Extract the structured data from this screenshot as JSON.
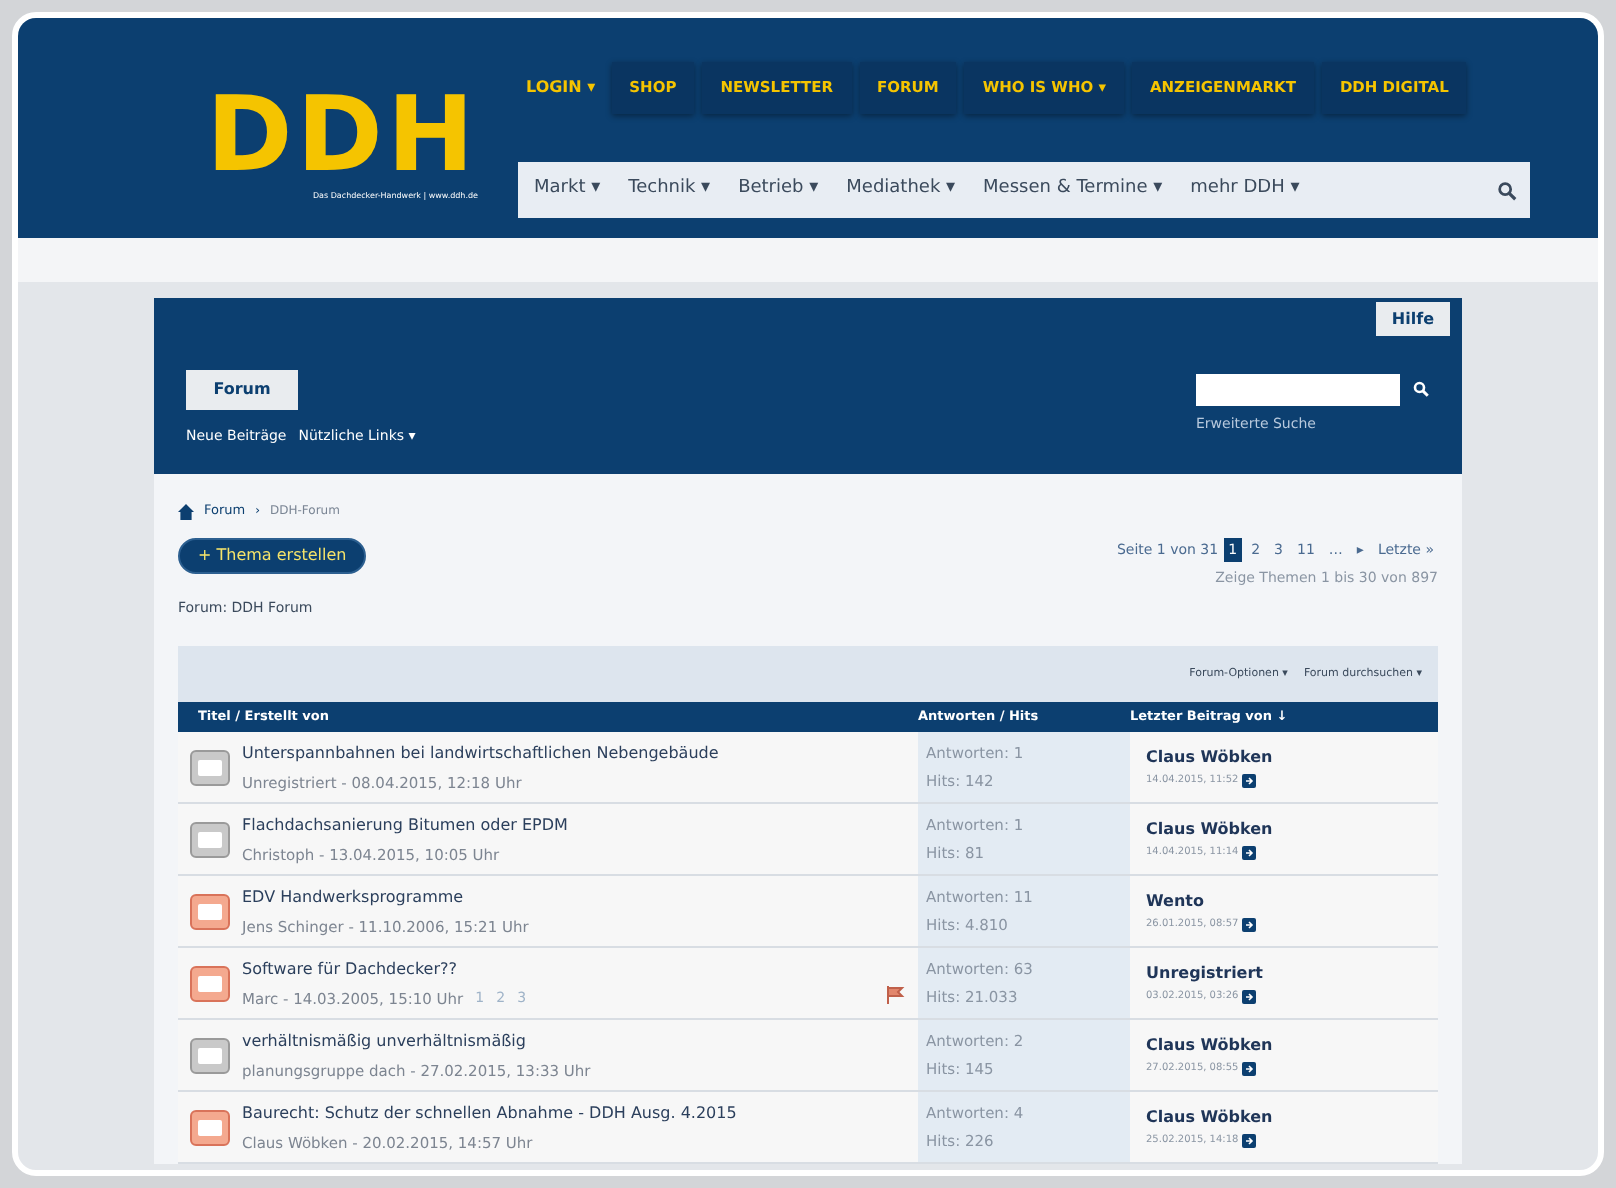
{
  "logo": {
    "text": "DDH",
    "tagline": "Das Dachdecker-Handwerk | www.ddh.de"
  },
  "login": "LOGIN ▾",
  "top_nav": [
    "SHOP",
    "NEWSLETTER",
    "FORUM",
    "WHO IS WHO ▾",
    "ANZEIGENMARKT",
    "DDH DIGITAL"
  ],
  "main_nav": [
    "Markt ▾",
    "Technik ▾",
    "Betrieb ▾",
    "Mediathek ▾",
    "Messen & Termine ▾",
    "mehr DDH ▾"
  ],
  "forum_header": {
    "help": "Hilfe",
    "tab": "Forum",
    "links": [
      "Neue Beiträge",
      "Nützliche Links ▾"
    ],
    "advanced_search": "Erweiterte Suche"
  },
  "breadcrumb": [
    "Forum",
    "›",
    "DDH-Forum"
  ],
  "new_thread": "+ Thema erstellen",
  "pagination": {
    "label": "Seite 1 von 31",
    "pages": [
      {
        "label": "1",
        "selected": true
      },
      {
        "label": "2",
        "selected": false
      },
      {
        "label": "3",
        "selected": false
      },
      {
        "label": "11",
        "selected": false
      },
      {
        "label": "…",
        "selected": false
      },
      {
        "label": "▸",
        "selected": false
      },
      {
        "label": "Letzte »",
        "selected": false
      }
    ],
    "summary": "Zeige Themen 1 bis 30 von 897"
  },
  "forum_title": "Forum: DDH Forum",
  "options": [
    "Forum-Optionen ▾",
    "Forum durchsuchen ▾"
  ],
  "table": {
    "columns": [
      "Titel / Erstellt von",
      "Antworten / Hits",
      "Letzter Beitrag von ↓"
    ],
    "rows": [
      {
        "kind": "normal",
        "title": "Unterspannbahnen bei landwirtschaftlichen Nebengebäude",
        "meta": "Unregistriert - 08.04.2015, 12:18 Uhr",
        "replies": "Antworten: 1",
        "hits": "Hits: 142",
        "last_user": "Claus Wöbken",
        "last_date": "14.04.2015, 11:52"
      },
      {
        "kind": "normal",
        "title": "Flachdachsanierung Bitumen oder EPDM",
        "meta": "Christoph - 13.04.2015, 10:05 Uhr",
        "replies": "Antworten: 1",
        "hits": "Hits: 81",
        "last_user": "Claus Wöbken",
        "last_date": "14.04.2015, 11:14"
      },
      {
        "kind": "hot",
        "title": "EDV Handwerksprogramme",
        "meta": "Jens Schinger - 11.10.2006, 15:21 Uhr",
        "replies": "Antworten: 11",
        "hits": "Hits: 4.810",
        "last_user": "Wento",
        "last_date": "26.01.2015, 08:57"
      },
      {
        "kind": "hot",
        "title": "Software für Dachdecker??",
        "meta": "Marc - 14.03.2005, 15:10 Uhr",
        "pages": [
          "1",
          "2",
          "3"
        ],
        "flag": true,
        "replies": "Antworten: 63",
        "hits": "Hits: 21.033",
        "last_user": "Unregistriert",
        "last_date": "03.02.2015, 03:26"
      },
      {
        "kind": "normal",
        "title": "verhältnismäßig unverhältnismäßig",
        "meta": "planungsgruppe dach - 27.02.2015, 13:33 Uhr",
        "replies": "Antworten: 2",
        "hits": "Hits: 145",
        "last_user": "Claus Wöbken",
        "last_date": "27.02.2015, 08:55"
      },
      {
        "kind": "hot",
        "title": "Baurecht: Schutz der schnellen Abnahme - DDH Ausg. 4.2015",
        "meta": "Claus Wöbken - 20.02.2015, 14:57 Uhr",
        "replies": "Antworten: 4",
        "hits": "Hits: 226",
        "last_user": "Claus Wöbken",
        "last_date": "25.02.2015, 14:18"
      }
    ]
  }
}
